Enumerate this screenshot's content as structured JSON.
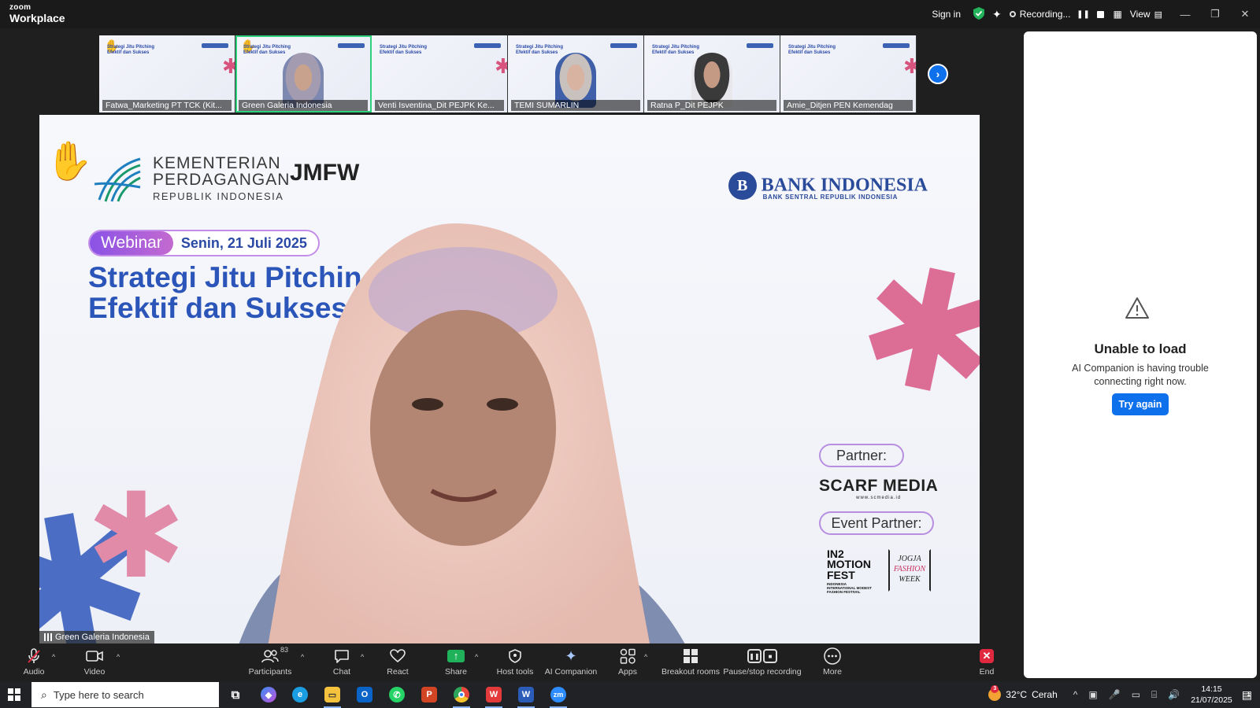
{
  "app": {
    "brand_top": "zoom",
    "brand_bottom": "Workplace",
    "sign_in": "Sign in",
    "recording": "Recording...",
    "view": "View",
    "accent": "#0e71eb"
  },
  "participants": [
    {
      "name": "Fatwa_Marketing PT TCK (Kit..."
    },
    {
      "name": "Green Galeria Indonesia",
      "active": true
    },
    {
      "name": "Venti Isventina_Dit PEJPK Ke..."
    },
    {
      "name": "TEMI SUMARLIN"
    },
    {
      "name": "Ratna P_Dit PEJPK"
    },
    {
      "name": "Amie_Ditjen PEN Kemendag"
    }
  ],
  "tile_slide_title": "Strategi Jitu Pitching Efektif dan Sukses",
  "slide": {
    "ministry_l1": "KEMENTERIAN",
    "ministry_l2": "PERDAGANGAN",
    "ministry_l3": "REPUBLIK INDONESIA",
    "jmfw": "JMFW",
    "bank_name": "BANK INDONESIA",
    "bank_sub": "BANK SENTRAL REPUBLIK INDONESIA",
    "webinar": "Webinar",
    "date": "Senin, 21 Juli 2025",
    "headline_l1": "Strategi Jitu Pitchin",
    "headline_l2": "Efektif dan Sukses",
    "partner_label": "Partner:",
    "scarf": "SCARF MEDIA",
    "scarf_url": "www.scmedia.id",
    "event_partner_label": "Event Partner:",
    "in2": "IN2 MOTION FEST",
    "in2_sub": "INDONESIA INTERNATIONAL MODEST FASHION FESTIVAL",
    "jfw_l1": "JOGJA",
    "jfw_l2": "FASHION",
    "jfw_l3": "WEEK"
  },
  "speaker_name": "Green Galeria Indonesia",
  "side_panel": {
    "title": "Unable to load",
    "message": "AI Companion is having trouble connecting right now.",
    "button": "Try again"
  },
  "toolbar": {
    "audio": "Audio",
    "video": "Video",
    "participants": "Participants",
    "participants_count": "83",
    "chat": "Chat",
    "react": "React",
    "share": "Share",
    "host_tools": "Host tools",
    "ai_companion": "AI Companion",
    "apps": "Apps",
    "breakout": "Breakout rooms",
    "pause_stop": "Pause/stop recording",
    "more": "More",
    "end": "End"
  },
  "taskbar": {
    "search_placeholder": "Type here to search",
    "temperature": "32°C",
    "weather": "Cerah",
    "time": "14:15",
    "date": "21/07/2025",
    "weather_badge": "3",
    "notif_count": "1"
  }
}
